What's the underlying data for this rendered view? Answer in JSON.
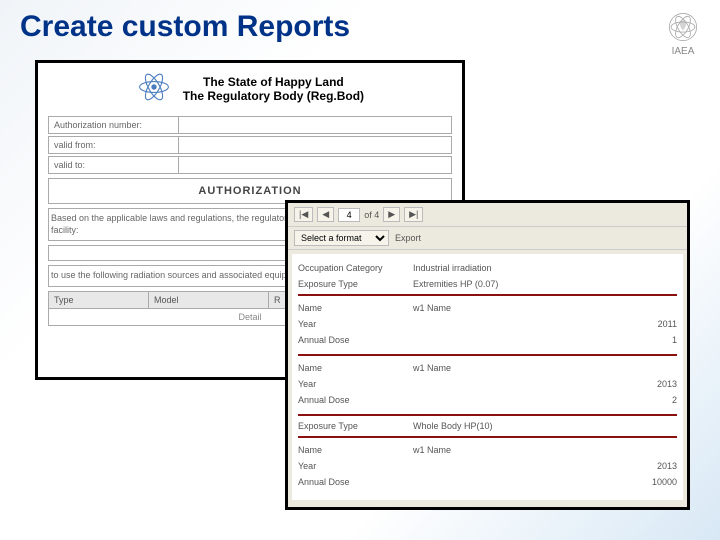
{
  "slide": {
    "title": "Create custom Reports"
  },
  "brand": {
    "org": "IAEA"
  },
  "doc1": {
    "org_line1": "The State of Happy Land",
    "org_line2": "The Regulatory Body (Reg.Bod)",
    "rows": {
      "auth_no_label": "Authorization number:",
      "valid_from_label": "valid from:",
      "valid_to_label": "valid to:"
    },
    "authz": "AUTHORIZATION",
    "para1": "Based on the applicable laws and regulations, the regulatory body of the Happy Land authorizes the facility:",
    "para2": "to use the following radiation sources and associated equipment:",
    "table": {
      "c1": "Type",
      "c2": "Model",
      "c3": "R"
    },
    "detail": "Detail"
  },
  "doc2": {
    "toolbar": {
      "first": "|◀",
      "prev": "◀",
      "page": "4",
      "of_label": "of 4",
      "next": "▶",
      "last": "▶|"
    },
    "toolbar2": {
      "format_placeholder": "Select a format",
      "export": "Export"
    },
    "header": {
      "occ_cat_k": "Occupation Category",
      "occ_cat_v": "Industrial irradiation",
      "exp_type_k": "Exposure Type",
      "exp_type_v": "Extremities HP (0.07)"
    },
    "records": [
      {
        "name_k": "Name",
        "name_v": "w1 Name",
        "year_k": "Year",
        "year_v": "2011",
        "dose_k": "Annual Dose",
        "dose_v": "1"
      },
      {
        "name_k": "Name",
        "name_v": "w1 Name",
        "year_k": "Year",
        "year_v": "2013",
        "dose_k": "Annual Dose",
        "dose_v": "2"
      }
    ],
    "section2_k": "Exposure Type",
    "section2_v": "Whole Body HP(10)",
    "records2": [
      {
        "name_k": "Name",
        "name_v": "w1 Name",
        "year_k": "Year",
        "year_v": "2013",
        "dose_k": "Annual Dose",
        "dose_v": "10000"
      }
    ]
  }
}
